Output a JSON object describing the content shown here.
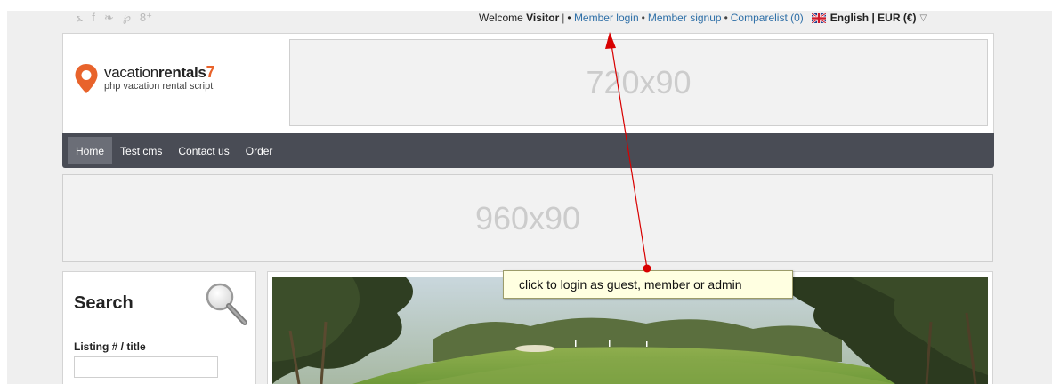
{
  "social": {
    "icons": [
      {
        "name": "rss-icon",
        "glyph": "⦩"
      },
      {
        "name": "facebook-icon",
        "glyph": "f"
      },
      {
        "name": "twitter-icon",
        "glyph": "❧"
      },
      {
        "name": "pinterest-icon",
        "glyph": "℘"
      },
      {
        "name": "googleplus-icon",
        "glyph": "8⁺"
      }
    ]
  },
  "topbar": {
    "welcome": "Welcome",
    "visitor": "Visitor",
    "pipe": "|",
    "bullet": "•",
    "member_login": "Member login",
    "member_signup": "Member signup",
    "comparelist": "Comparelist (0)",
    "language_currency": "English | EUR (€)",
    "caret": "▽"
  },
  "logo": {
    "main_light": "vacation",
    "main_bold": "rentals",
    "main_number": "7",
    "sub": "php vacation rental script",
    "accent_color": "#e8632b"
  },
  "banners": {
    "top": "720x90",
    "wide": "960x90"
  },
  "nav": {
    "items": [
      {
        "label": "Home",
        "active": true
      },
      {
        "label": "Test cms",
        "active": false
      },
      {
        "label": "Contact us",
        "active": false
      },
      {
        "label": "Order",
        "active": false
      }
    ],
    "bg_color": "#494c55"
  },
  "sidebar": {
    "title": "Search",
    "listing_label": "Listing # / title",
    "listing_value": ""
  },
  "tooltip": {
    "text": "click to login as guest, member or admin"
  }
}
